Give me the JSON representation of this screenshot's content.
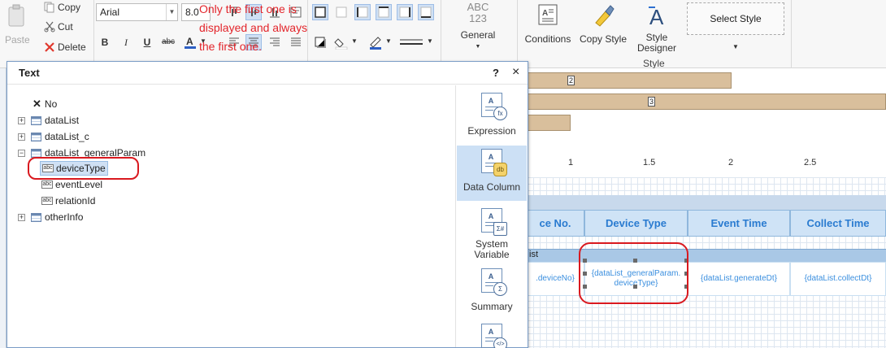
{
  "ribbon": {
    "paste_label": "Paste",
    "copy_label": "Copy",
    "cut_label": "Cut",
    "delete_label": "Delete",
    "font_name": "Arial",
    "font_size": "8.0",
    "general_icon_top": "ABC",
    "general_icon_bottom": "123",
    "general_label": "General",
    "conditions_label": "Conditions",
    "copy_style_label": "Copy Style",
    "style_designer_label": "Style\nDesigner",
    "select_style_label": "Select Style",
    "style_group_label": "Style",
    "bold": "B",
    "italic": "I",
    "underline": "U",
    "strike": "abc"
  },
  "annotation": {
    "text": "Only the first one is displayed and always the first one."
  },
  "chart": {
    "bar_labels": [
      "2",
      "3"
    ],
    "ticks": [
      "1",
      "1.5",
      "2",
      "2.5"
    ],
    "values": [
      2,
      3,
      1
    ]
  },
  "table": {
    "partial_header": "ce No.",
    "headers": [
      "Device Type",
      "Event Time",
      "Collect Time"
    ],
    "band_label": "ist",
    "cells": [
      ".deviceNo}",
      "{dataList_generalParam.\ndeviceType}",
      "{dataList.generateDt}",
      "{dataList.collectDt}"
    ]
  },
  "dialog": {
    "title": "Text",
    "help": "?",
    "close": "×",
    "tree": [
      {
        "label": "No",
        "kind": "none"
      },
      {
        "label": "dataList",
        "kind": "table",
        "expander": "+"
      },
      {
        "label": "dataList_c",
        "kind": "table",
        "expander": "+"
      },
      {
        "label": "dataList_generalParam",
        "kind": "table",
        "expander": "−"
      },
      {
        "label": "deviceType",
        "kind": "field"
      },
      {
        "label": "eventLevel",
        "kind": "field"
      },
      {
        "label": "relationId",
        "kind": "field"
      },
      {
        "label": "otherInfo",
        "kind": "table",
        "expander": "+"
      }
    ],
    "side": [
      {
        "label": "Expression",
        "badge": "fx"
      },
      {
        "label": "Data Column",
        "badge": "db"
      },
      {
        "label": "System\nVariable",
        "badge": "Σ#"
      },
      {
        "label": "Summary",
        "badge": "Σ"
      },
      {
        "label": "",
        "badge": "</>"
      }
    ],
    "field_icon": "abc"
  }
}
